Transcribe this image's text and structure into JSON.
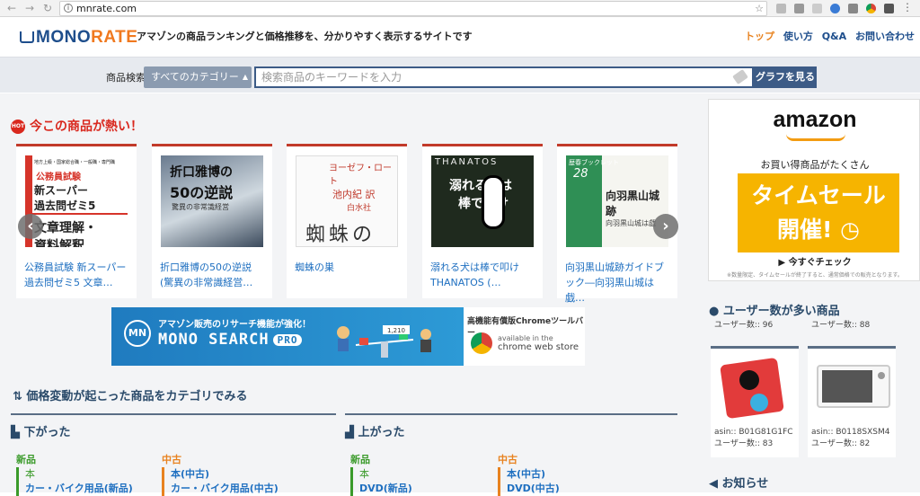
{
  "browser": {
    "url": "mnrate.com"
  },
  "header": {
    "logo_mono": "MONO",
    "logo_rate": "RATE",
    "tagline": "アマゾンの商品ランキングと価格推移を、分かりやすく表示するサイトです",
    "nav": [
      "トップ",
      "使い方",
      "Q&A",
      "お問い合わせ"
    ]
  },
  "search": {
    "label": "商品検索",
    "category": "すべてのカテゴリー",
    "placeholder": "検索商品のキーワードを入力",
    "button": "グラフを見る"
  },
  "hot": {
    "badge": "HOT",
    "title": "今この商品が熱い！",
    "items": [
      {
        "title": "公務員試験 新スーパー過去問ゼミ5 文章…"
      },
      {
        "title": "折口雅博の50の逆説 (驚異の非常識経営…"
      },
      {
        "title": "蜘蛛の巣"
      },
      {
        "title": "溺れる犬は棒で叩け THANATOS (…"
      },
      {
        "title": "向羽黒山城跡ガイドブック―向羽黒山城は戯…"
      }
    ]
  },
  "covers": {
    "c1": [
      "地方上級・国家総合職・一般職・専門職",
      "公務員試験",
      "新スーパー",
      "過去問ゼミ5",
      "文章理解・",
      "資料解釈"
    ],
    "c2": [
      "折口雅博の",
      "50の逆説",
      "驚異の非常識経営"
    ],
    "c3": [
      "ヨーゼフ・ロート",
      "池内紀 訳",
      "白水社",
      "蜘蛛の巣"
    ],
    "c4": [
      "THANATOS",
      "溺れる犬は",
      "棒で叩け"
    ],
    "c5": [
      "歴春ブックレット",
      "28",
      "向羽黒山城跡",
      "向羽黒山城は戯"
    ]
  },
  "banner": {
    "logo": "MN",
    "line1": "アマゾン販売のリサーチ機能が強化！",
    "line2": "MONO SEARCH",
    "pro": "PRO",
    "right_title": "高機能有償版Chromeツールバー",
    "store1": "available in the",
    "store2": "chrome web store",
    "scale_value": "1,210"
  },
  "category_section": {
    "title": "価格変動が起こった商品をカテゴリでみる",
    "down": "下がった",
    "up": "上がった",
    "columns": [
      {
        "label": "新品",
        "items": [
          "本",
          "カー・バイク用品(新品)"
        ]
      },
      {
        "label": "中古",
        "items": [
          "本(中古)",
          "カー・バイク用品(中古)"
        ]
      },
      {
        "label": "新品",
        "items": [
          "本",
          "DVD(新品)"
        ]
      },
      {
        "label": "中古",
        "items": [
          "本(中古)",
          "DVD(中古)"
        ]
      }
    ]
  },
  "ad": {
    "brand": "amazon",
    "line1": "お買い得商品がたくさん",
    "sale1": "タイムセール",
    "sale2": "開催!",
    "cta": "▶ 今すぐチェック",
    "note": "※数量限定、タイムセールが終了すると、通常価格での販売となります。"
  },
  "users": {
    "title": "ユーザー数が多い商品",
    "top_counts": [
      "ユーザー数:: 96",
      "ユーザー数:: 88"
    ],
    "items": [
      {
        "asin": "asin:: B01G81G1FC",
        "count": "ユーザー数:: 83"
      },
      {
        "asin": "asin:: B0118SXSM4",
        "count": "ユーザー数:: 82"
      }
    ]
  },
  "news": {
    "title": "お知らせ"
  }
}
